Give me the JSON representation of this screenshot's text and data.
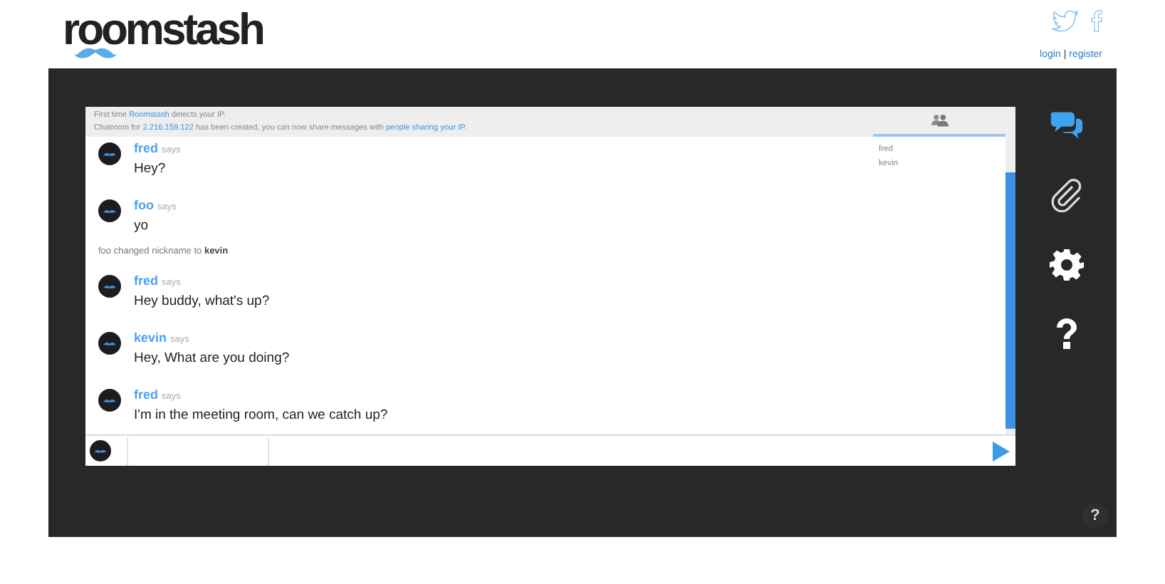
{
  "header": {
    "logo": "roomstash",
    "links": [
      {
        "label": "login"
      },
      {
        "label": "register"
      }
    ],
    "separator": "|"
  },
  "notice": [
    [
      {
        "kind": "plain",
        "text": "First time "
      },
      {
        "kind": "link",
        "text": "Roomstash"
      },
      {
        "kind": "plain",
        "text": " detects your IP."
      }
    ],
    [
      {
        "kind": "plain",
        "text": "Chatroom for "
      },
      {
        "kind": "link",
        "text": "2.216.159.122"
      },
      {
        "kind": "plain",
        "text": " has been created, you can now share messages with "
      },
      {
        "kind": "link",
        "text": "people sharing your IP"
      },
      {
        "kind": "plain",
        "text": "."
      }
    ]
  ],
  "users": [
    "fred",
    "kevin"
  ],
  "messages": [
    {
      "kind": "message",
      "author": "fred",
      "says": "says",
      "text": "Hey?"
    },
    {
      "kind": "message",
      "author": "foo",
      "says": "says",
      "text": "yo"
    },
    {
      "kind": "event",
      "text": "foo changed nickname to **kevin**"
    },
    {
      "kind": "message",
      "author": "fred",
      "says": "says",
      "text": "Hey buddy, what's up?"
    },
    {
      "kind": "message",
      "author": "kevin",
      "says": "says",
      "text": "Hey, What are you doing?"
    },
    {
      "kind": "message",
      "author": "fred",
      "says": "says",
      "text": "I'm in the meeting room, can we catch up?"
    }
  ],
  "sidebar": [
    {
      "kind": "chat",
      "selected": true
    },
    {
      "kind": "attach",
      "selected": false
    },
    {
      "kind": "settings",
      "selected": false
    },
    {
      "kind": "help",
      "selected": false
    }
  ],
  "help_button": "?"
}
